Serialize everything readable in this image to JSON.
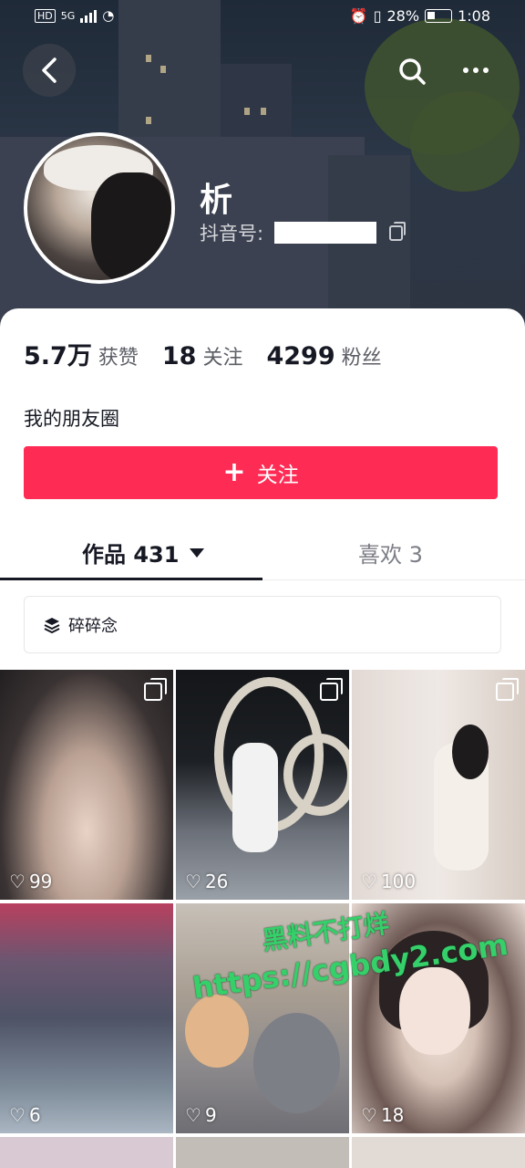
{
  "status_bar": {
    "left_badge": "HD",
    "network": "5G",
    "battery": "28%",
    "time": "1:08"
  },
  "header": {
    "nickname": "析",
    "douyin_id_label": "抖音号:"
  },
  "stats": [
    {
      "value": "5.7万",
      "label": "获赞"
    },
    {
      "value": "18",
      "label": "关注"
    },
    {
      "value": "4299",
      "label": "粉丝"
    }
  ],
  "bio": "我的朋友圈",
  "follow_button": {
    "icon": "+",
    "label": "关注"
  },
  "tabs": {
    "works": "作品 431",
    "likes": "喜欢 3"
  },
  "collection": {
    "label": "碎碎念"
  },
  "videos": [
    {
      "likes": "99"
    },
    {
      "likes": "26"
    },
    {
      "likes": "100"
    },
    {
      "likes": "6"
    },
    {
      "likes": "9"
    },
    {
      "likes": "18"
    }
  ],
  "watermark": {
    "line1": "黑料不打烊",
    "line2": "https://cgbdy2.com"
  },
  "colors": {
    "accent": "#fe2c55",
    "text_primary": "#161823",
    "text_secondary": "#5c5e66"
  }
}
